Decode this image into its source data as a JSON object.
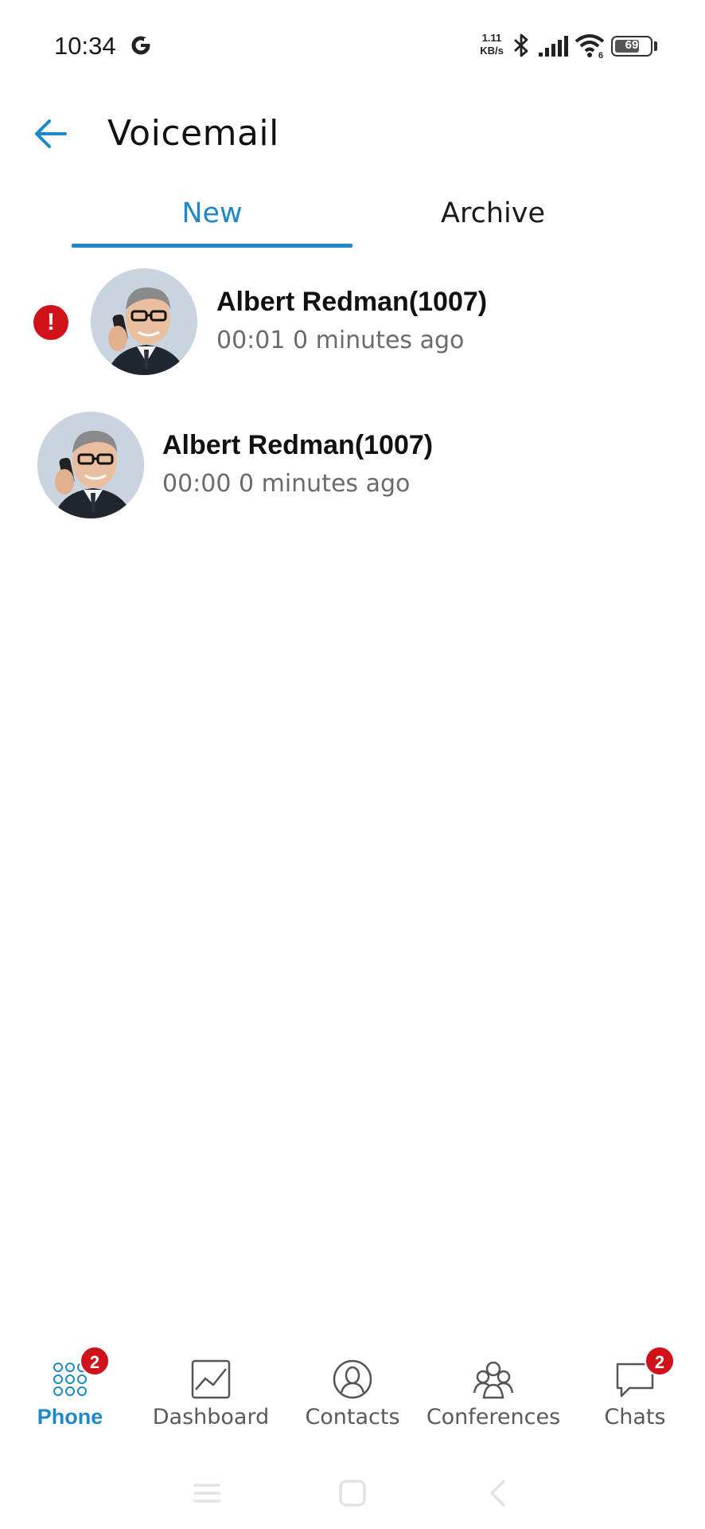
{
  "status_bar": {
    "time": "10:34",
    "net_speed_value": "1.11",
    "net_speed_unit": "KB/s",
    "wifi_label": "6",
    "battery_level": "69",
    "icons": [
      "google-icon",
      "bluetooth-icon",
      "signal-icon",
      "wifi-icon",
      "battery-icon"
    ]
  },
  "header": {
    "title": "Voicemail",
    "back_icon": "arrow-left-icon"
  },
  "tabs": [
    {
      "label": "New",
      "active": true
    },
    {
      "label": "Archive",
      "active": false
    }
  ],
  "voicemails": [
    {
      "name": "Albert Redman(1007)",
      "meta": "00:01 0 minutes ago",
      "unheard_alert": true,
      "alert_symbol": "!"
    },
    {
      "name": "Albert Redman(1007)",
      "meta": "00:00 0 minutes ago",
      "unheard_alert": false
    }
  ],
  "bottom_nav": {
    "items": [
      {
        "label": "Phone",
        "icon": "dialpad-icon",
        "active": true,
        "badge": "2"
      },
      {
        "label": "Dashboard",
        "icon": "chart-icon",
        "active": false
      },
      {
        "label": "Contacts",
        "icon": "contact-icon",
        "active": false
      },
      {
        "label": "Conferences",
        "icon": "group-icon",
        "active": false
      },
      {
        "label": "Chats",
        "icon": "chat-bubble-icon",
        "active": false,
        "badge": "2"
      }
    ]
  },
  "colors": {
    "accent": "#1e88c9",
    "alert": "#d0121b",
    "secondary_text": "#6b6b6b"
  }
}
